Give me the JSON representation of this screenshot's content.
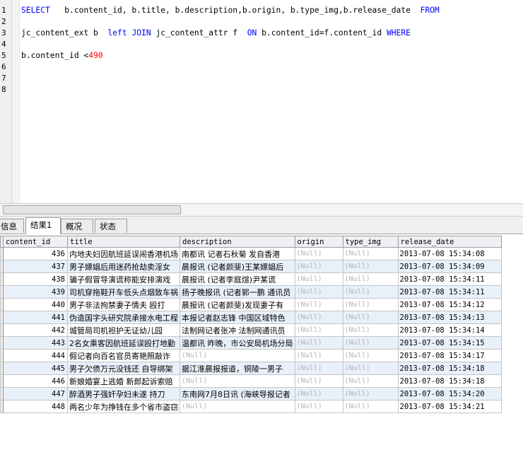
{
  "editor": {
    "line_numbers": [
      "1",
      "2",
      "3",
      "4",
      "5",
      "6",
      "7",
      "8"
    ],
    "line1": {
      "kw_select": "SELECT",
      "fields": "   b.content_id, b.title, b.description,b.origin, b.type_img,b.release_date  ",
      "kw_from": "FROM"
    },
    "line3": {
      "table1": "jc_content_ext b  ",
      "kw_left_join": "left JOIN",
      "table2": " jc_content_attr f  ",
      "kw_on": "ON",
      "cond": " b.content_id=f.content_id ",
      "kw_where": "WHERE"
    },
    "line5": {
      "expr": "b.content_id <",
      "value": "490"
    }
  },
  "tabs": [
    "信息",
    "结果1",
    "概况",
    "状态"
  ],
  "grid": {
    "columns": [
      "content_id",
      "title",
      "description",
      "origin",
      "type_img",
      "release_date"
    ],
    "rows": [
      {
        "content_id": "436",
        "title": "内地夫妇因航班延误闹香港机场",
        "description": "南都讯 记者石秋菊 发自香港",
        "origin": "(Null)",
        "type_img": "(Null)",
        "release_date": "2013-07-08 15:34:08"
      },
      {
        "content_id": "437",
        "title": "男子嫖娼后用迷药抢劫卖淫女",
        "description": "晨报讯 (记者颜斐)王某嫖娼后",
        "origin": "(Null)",
        "type_img": "(Null)",
        "release_date": "2013-07-08 15:34:09"
      },
      {
        "content_id": "438",
        "title": "骗子假冒导演谎称能安排演戏",
        "description": "晨报讯 (记者李庭煊)尹某谎",
        "origin": "(Null)",
        "type_img": "(Null)",
        "release_date": "2013-07-08 15:34:11"
      },
      {
        "content_id": "439",
        "title": "司机穿拖鞋开车低头点烟致车祸",
        "description": "扬子晚报讯 (记者郭一鹏 通讯员",
        "origin": "(Null)",
        "type_img": "(Null)",
        "release_date": "2013-07-08 15:34:11"
      },
      {
        "content_id": "440",
        "title": "男子非法拘禁妻子情夫 殴打",
        "description": "晨报讯 (记者颜斐)发现妻子有",
        "origin": "(Null)",
        "type_img": "(Null)",
        "release_date": "2013-07-08 15:34:12"
      },
      {
        "content_id": "441",
        "title": "伪造国字头研究院承接水电工程",
        "description": "本报记者赵志锋 中国区域特色",
        "origin": "(Null)",
        "type_img": "(Null)",
        "release_date": "2013-07-08 15:34:13"
      },
      {
        "content_id": "442",
        "title": "城管局司机袒护无证幼儿园",
        "description": "法制网记者张冲 法制网通讯员",
        "origin": "(Null)",
        "type_img": "(Null)",
        "release_date": "2013-07-08 15:34:14"
      },
      {
        "content_id": "443",
        "title": "2名女乘客因航班延误殴打地勤",
        "description": "温都讯 昨晚，市公安局机场分局",
        "origin": "(Null)",
        "type_img": "(Null)",
        "release_date": "2013-07-08 15:34:15"
      },
      {
        "content_id": "444",
        "title": "假记者向百名官员寄艳照敲诈",
        "description": "(Null)",
        "origin": "(Null)",
        "type_img": "(Null)",
        "release_date": "2013-07-08 15:34:17"
      },
      {
        "content_id": "445",
        "title": "男子欠债万元没钱还 自导绑架",
        "description": "据江淮晨报报道，铜陵一男子",
        "origin": "(Null)",
        "type_img": "(Null)",
        "release_date": "2013-07-08 15:34:18"
      },
      {
        "content_id": "446",
        "title": "新娘婚宴上逃婚 新郎起诉索赔",
        "description": "(Null)",
        "origin": "(Null)",
        "type_img": "(Null)",
        "release_date": "2013-07-08 15:34:18"
      },
      {
        "content_id": "447",
        "title": "醉酒男子强奸孕妇未遂 持刀",
        "description": "东南网7月8日讯 (海峡导报记者",
        "origin": "(Null)",
        "type_img": "(Null)",
        "release_date": "2013-07-08 15:34:20"
      },
      {
        "content_id": "448",
        "title": "两名少年为挣钱在多个省市盗窃",
        "description": "(Null)",
        "origin": "(Null)",
        "type_img": "(Null)",
        "release_date": "2013-07-08 15:34:21"
      }
    ]
  }
}
